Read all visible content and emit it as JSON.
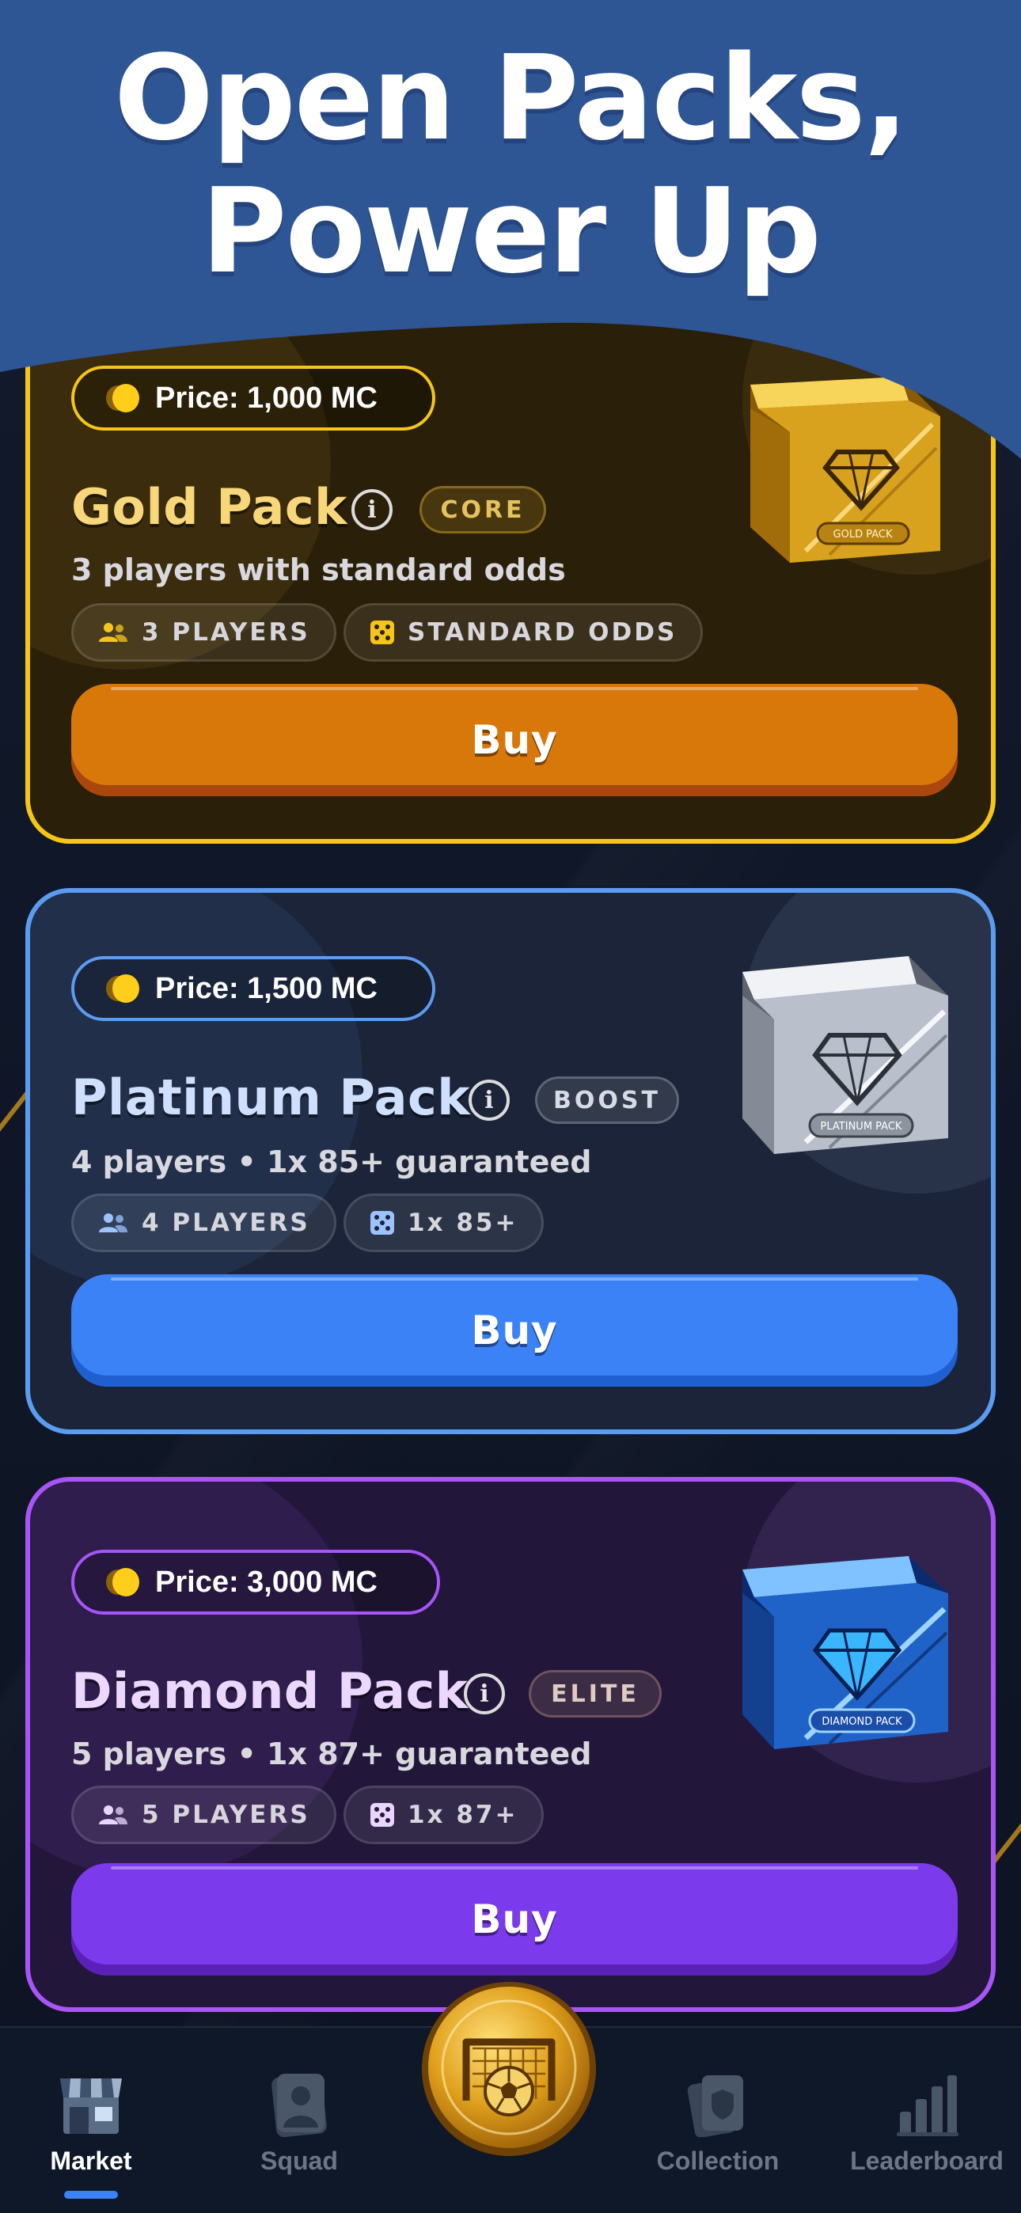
{
  "header": {
    "title_line1": "Open Packs,",
    "title_line2": "Power Up"
  },
  "colors": {
    "header_blue": "#2e5594",
    "gold_accent": "#f5c518",
    "platinum_accent": "#5b9cf0",
    "diamond_accent": "#a855f7",
    "gold_button": "#d9780a",
    "platinum_button": "#3b82f6",
    "diamond_button": "#7c3aed",
    "nav_active_indicator": "#3b82f6"
  },
  "packs": [
    {
      "price": "Price: 1,000 MC",
      "name": "Gold Pack",
      "tag": "CORE",
      "subtitle": "3 players with standard odds",
      "chips": [
        "3 PLAYERS",
        "STANDARD ODDS"
      ],
      "buy_label": "Buy",
      "image_label": "GOLD PACK",
      "icons": [
        "coin-icon",
        "info-icon",
        "players-icon",
        "dice-icon"
      ]
    },
    {
      "price": "Price: 1,500 MC",
      "name": "Platinum Pack",
      "tag": "BOOST",
      "subtitle": "4 players • 1x 85+ guaranteed",
      "chips": [
        "4 PLAYERS",
        "1x 85+"
      ],
      "buy_label": "Buy",
      "image_label": "PLATINUM PACK",
      "icons": [
        "coin-icon",
        "info-icon",
        "players-icon",
        "dice-icon"
      ]
    },
    {
      "price": "Price: 3,000 MC",
      "name": "Diamond Pack",
      "tag": "ELITE",
      "subtitle": "5 players • 1x 87+ guaranteed",
      "chips": [
        "5 PLAYERS",
        "1x 87+"
      ],
      "buy_label": "Buy",
      "image_label": "DIAMOND PACK",
      "icons": [
        "coin-icon",
        "info-icon",
        "players-icon",
        "dice-icon"
      ]
    }
  ],
  "nav": {
    "items": [
      {
        "label": "Market",
        "icon": "market-icon",
        "active": true
      },
      {
        "label": "Squad",
        "icon": "squad-icon",
        "active": false
      },
      {
        "label": "",
        "icon": "soccer-goal-icon",
        "active": false
      },
      {
        "label": "Collection",
        "icon": "collection-icon",
        "active": false
      },
      {
        "label": "Leaderboard",
        "icon": "leaderboard-icon",
        "active": false
      }
    ]
  }
}
